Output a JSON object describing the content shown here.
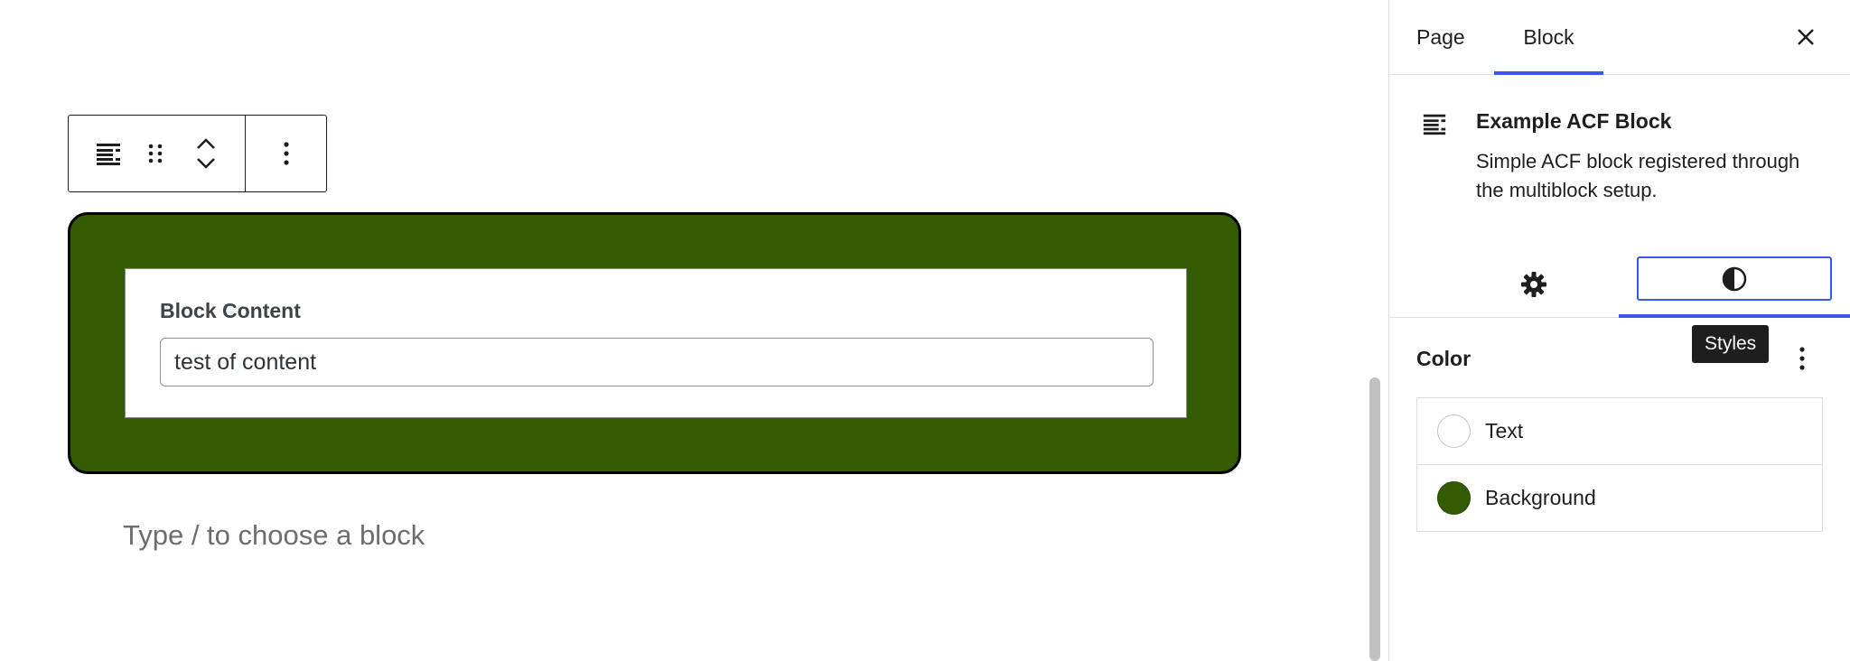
{
  "canvas": {
    "block": {
      "background_color": "#335c00",
      "field_label": "Block Content",
      "field_value": "test of content"
    },
    "appender_placeholder": "Type / to choose a block"
  },
  "toolbar": {
    "block_icon": "block-layout-icon",
    "drag_icon": "drag-handle-icon",
    "move_up_icon": "chevron-up-icon",
    "move_down_icon": "chevron-down-icon",
    "options_icon": "more-vertical-icon"
  },
  "sidebar": {
    "tabs": [
      {
        "label": "Page"
      },
      {
        "label": "Block"
      }
    ],
    "active_tab_color": "#3858e9",
    "block_card": {
      "title": "Example ACF Block",
      "description": "Simple ACF block registered through the multiblock setup."
    },
    "inspector_tabs": {
      "settings_icon": "gear-icon",
      "styles_icon": "contrast-icon",
      "tooltip": "Styles"
    },
    "color_panel": {
      "heading": "Color",
      "items": [
        {
          "label": "Text",
          "swatch": "#ffffff"
        },
        {
          "label": "Background",
          "swatch": "#335c00"
        }
      ]
    }
  }
}
